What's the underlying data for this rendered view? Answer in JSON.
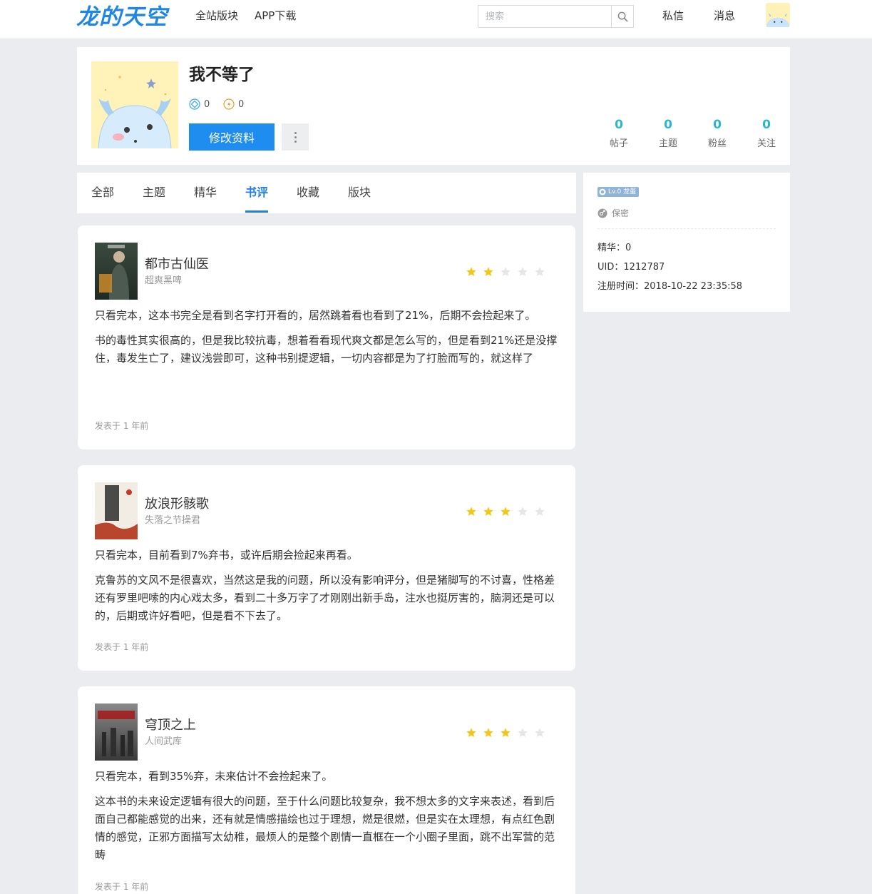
{
  "nav": {
    "logo": "龙的天空",
    "links": [
      "全站版块",
      "APP下载"
    ],
    "search_placeholder": "搜索",
    "messages": "私信",
    "notifications": "消息"
  },
  "profile": {
    "username": "我不等了",
    "coins": [
      "0",
      "0"
    ],
    "edit_label": "修改资料",
    "stats": [
      {
        "value": "0",
        "label": "帖子"
      },
      {
        "value": "0",
        "label": "主题"
      },
      {
        "value": "0",
        "label": "粉丝"
      },
      {
        "value": "0",
        "label": "关注"
      }
    ]
  },
  "tabs": [
    "全部",
    "主题",
    "精华",
    "书评",
    "收藏",
    "版块"
  ],
  "active_tab": 3,
  "reviews": [
    {
      "title": "都市古仙医",
      "author": "超爽黑啤",
      "rating": 2,
      "paragraphs": [
        "只看完本，这本书完全是看到名字打开看的，居然跳着看也看到了21%，后期不会捡起来了。",
        "书的毒性其实很高的，但是我比较抗毒，想着看看现代爽文都是怎么写的，但是看到21%还是没撑住，毒发生亡了，建议浅尝即可，这种书别提逻辑，一切内容都是为了打脸而写的，就这样了"
      ],
      "time": "发表于 1 年前"
    },
    {
      "title": "放浪形骸歌",
      "author": "失落之节操君",
      "rating": 3,
      "paragraphs": [
        "只看完本，目前看到7%弃书，或许后期会捡起来再看。",
        "克鲁苏的文风不是很喜欢，当然这是我的问题，所以没有影响评分，但是猪脚写的不讨喜，性格差还有罗里吧嗦的内心戏太多，看到二十多万字了才刚刚出新手岛，注水也挺厉害的，脑洞还是可以的，后期或许好看吧，但是看不下去了。"
      ],
      "time": "发表于 1 年前"
    },
    {
      "title": "穹顶之上",
      "author": "人间武库",
      "rating": 3,
      "paragraphs": [
        "只看完本，看到35%弃，未来估计不会捡起来了。",
        "这本书的未来设定逻辑有很大的问题，至于什么问题比较复杂，我不想太多的文字来表述，看到后面自己都能感觉的出来，还有就是情感描绘也过于理想，燃是很燃，但是实在太理想，有点红色剧情的感觉，正邪方面描写太幼稚，最烦人的是整个剧情一直框在一个小圈子里面，跳不出军营的范畴"
      ],
      "time": "发表于 1 年前"
    }
  ],
  "sidebar": {
    "level": "Lv.0 龙蛋",
    "gender": "保密",
    "essence": "精华：0",
    "uid": "UID：1212787",
    "registered": "注册时间：2018-10-22 23:35:58"
  },
  "colors": {
    "accent": "#1f8df0",
    "stat": "#2bb7c9",
    "star_on": "#f5c518",
    "star_off": "#e6e6e6"
  }
}
